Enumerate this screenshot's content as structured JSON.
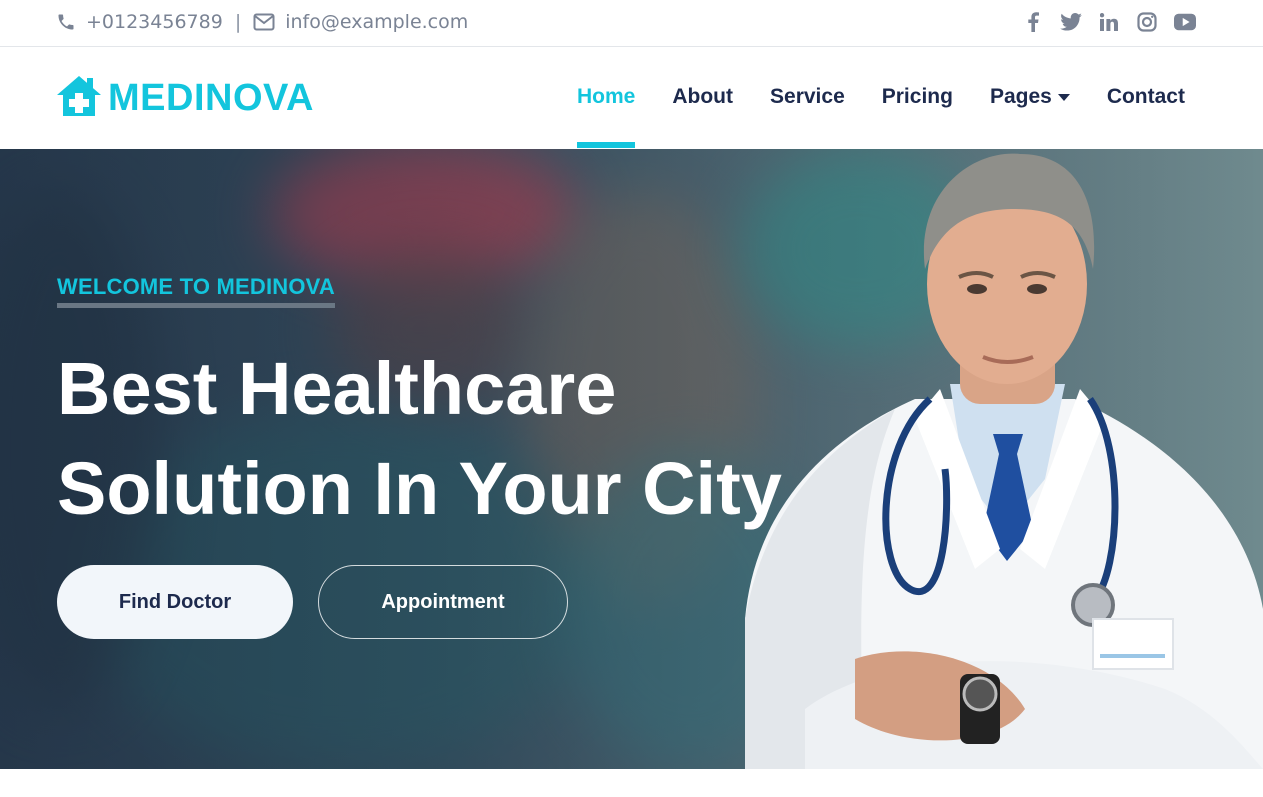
{
  "topbar": {
    "phone": "+0123456789",
    "separator": "|",
    "email": "info@example.com",
    "social": [
      "facebook-icon",
      "twitter-icon",
      "linkedin-icon",
      "instagram-icon",
      "youtube-icon"
    ]
  },
  "brand": {
    "name": "MEDINOVA",
    "icon": "house-medical-icon",
    "color": "#13c5dd"
  },
  "nav": {
    "items": [
      {
        "label": "Home",
        "active": true
      },
      {
        "label": "About"
      },
      {
        "label": "Service"
      },
      {
        "label": "Pricing"
      },
      {
        "label": "Pages",
        "dropdown": true
      },
      {
        "label": "Contact"
      }
    ]
  },
  "hero": {
    "eyebrow": "WELCOME TO MEDINOVA",
    "headline_line1": "Best Healthcare",
    "headline_line2": "Solution In Your City",
    "find_doctor": "Find Doctor",
    "appointment": "Appointment"
  },
  "colors": {
    "accent": "#13c5dd",
    "dark": "#1d2a4d"
  }
}
